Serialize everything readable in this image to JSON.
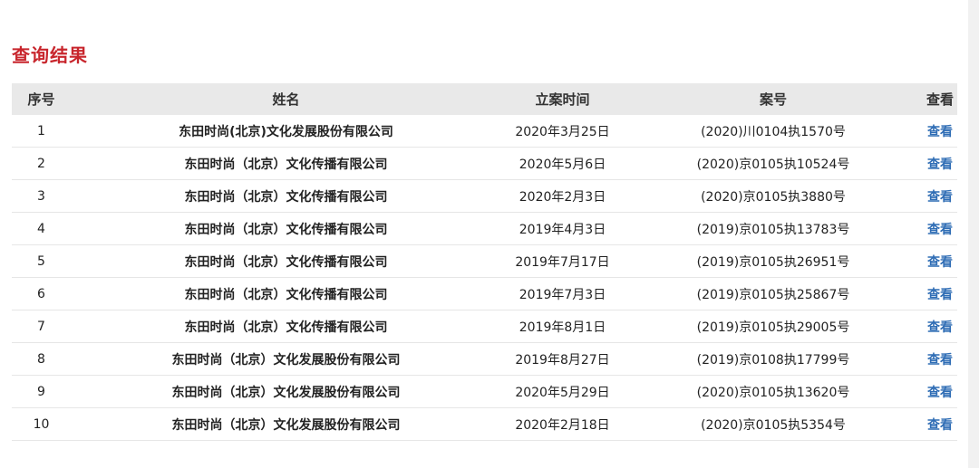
{
  "title": "查询结果",
  "columns": {
    "index": "序号",
    "name": "姓名",
    "date": "立案时间",
    "case_no": "案号",
    "action": "查看"
  },
  "rows": [
    {
      "index": "1",
      "name": "东田时尚(北京)文化发展股份有限公司",
      "date": "2020年3月25日",
      "case_no": "(2020)川0104执1570号",
      "action": "查看"
    },
    {
      "index": "2",
      "name": "东田时尚（北京）文化传播有限公司",
      "date": "2020年5月6日",
      "case_no": "(2020)京0105执10524号",
      "action": "查看"
    },
    {
      "index": "3",
      "name": "东田时尚（北京）文化传播有限公司",
      "date": "2020年2月3日",
      "case_no": "(2020)京0105执3880号",
      "action": "查看"
    },
    {
      "index": "4",
      "name": "东田时尚（北京）文化传播有限公司",
      "date": "2019年4月3日",
      "case_no": "(2019)京0105执13783号",
      "action": "查看"
    },
    {
      "index": "5",
      "name": "东田时尚（北京）文化传播有限公司",
      "date": "2019年7月17日",
      "case_no": "(2019)京0105执26951号",
      "action": "查看"
    },
    {
      "index": "6",
      "name": "东田时尚（北京）文化传播有限公司",
      "date": "2019年7月3日",
      "case_no": "(2019)京0105执25867号",
      "action": "查看"
    },
    {
      "index": "7",
      "name": "东田时尚（北京）文化传播有限公司",
      "date": "2019年8月1日",
      "case_no": "(2019)京0105执29005号",
      "action": "查看"
    },
    {
      "index": "8",
      "name": "东田时尚（北京）文化发展股份有限公司",
      "date": "2019年8月27日",
      "case_no": "(2019)京0108执17799号",
      "action": "查看"
    },
    {
      "index": "9",
      "name": "东田时尚（北京）文化发展股份有限公司",
      "date": "2020年5月29日",
      "case_no": "(2020)京0105执13620号",
      "action": "查看"
    },
    {
      "index": "10",
      "name": "东田时尚（北京）文化发展股份有限公司",
      "date": "2020年2月18日",
      "case_no": "(2020)京0105执5354号",
      "action": "查看"
    }
  ],
  "colors": {
    "title": "#c8262d",
    "header_bg": "#e9e9e9",
    "link": "#2f6db5"
  }
}
